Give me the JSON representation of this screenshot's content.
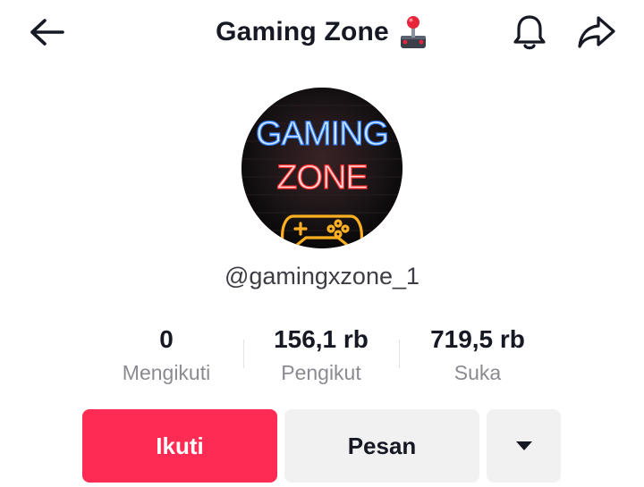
{
  "header": {
    "title": "Gaming Zone",
    "title_icon": "joystick-icon",
    "back_icon": "arrow-left-icon",
    "bell_icon": "bell-icon",
    "share_icon": "share-arrow-icon"
  },
  "profile": {
    "avatar_text_line1": "GAMING",
    "avatar_text_line2": "ZONE",
    "username": "@gamingxzone_1"
  },
  "stats": [
    {
      "value": "0",
      "label": "Mengikuti"
    },
    {
      "value": "156,1 rb",
      "label": "Pengikut"
    },
    {
      "value": "719,5 rb",
      "label": "Suka"
    }
  ],
  "actions": {
    "follow_label": "Ikuti",
    "message_label": "Pesan",
    "more_icon": "caret-down-icon"
  },
  "colors": {
    "primary": "#fe2c55",
    "secondary_bg": "#f1f1f2",
    "text": "#161823",
    "muted": "#8a8b91"
  }
}
